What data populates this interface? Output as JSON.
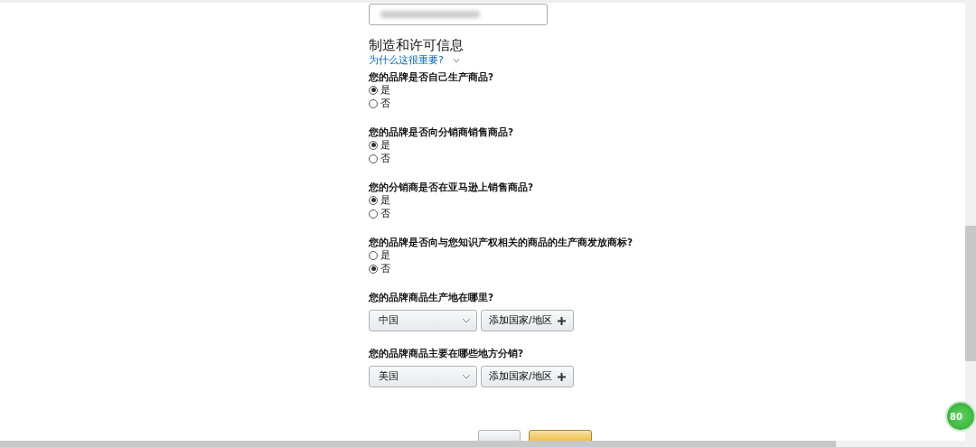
{
  "email_field": {
    "blurred": true
  },
  "section": {
    "title": "制造和许可信息",
    "help_link": "为什么这很重要?",
    "help_expanded": false
  },
  "questions": [
    {
      "label": "您的品牌是否自己生产商品?",
      "options": [
        {
          "label": "是",
          "selected": true
        },
        {
          "label": "否",
          "selected": false
        }
      ]
    },
    {
      "label": "您的品牌是否向分销商销售商品?",
      "options": [
        {
          "label": "是",
          "selected": true
        },
        {
          "label": "否",
          "selected": false
        }
      ]
    },
    {
      "label": "您的分销商是否在亚马逊上销售商品?",
      "options": [
        {
          "label": "是",
          "selected": true
        },
        {
          "label": "否",
          "selected": false
        }
      ]
    },
    {
      "label": "您的品牌是否向与您知识产权相关的商品的生产商发放商标?",
      "options": [
        {
          "label": "是",
          "selected": false
        },
        {
          "label": "否",
          "selected": true
        }
      ]
    }
  ],
  "locations": [
    {
      "label": "您的品牌商品生产地在哪里?",
      "value": "中国",
      "add_button": "添加国家/地区"
    },
    {
      "label": "您的品牌商品主要在哪些地方分销?",
      "value": "美国",
      "add_button": "添加国家/地区"
    }
  ],
  "footer_buttons": [
    {
      "kind": "secondary"
    },
    {
      "kind": "primary"
    }
  ],
  "floating_badge": "80"
}
